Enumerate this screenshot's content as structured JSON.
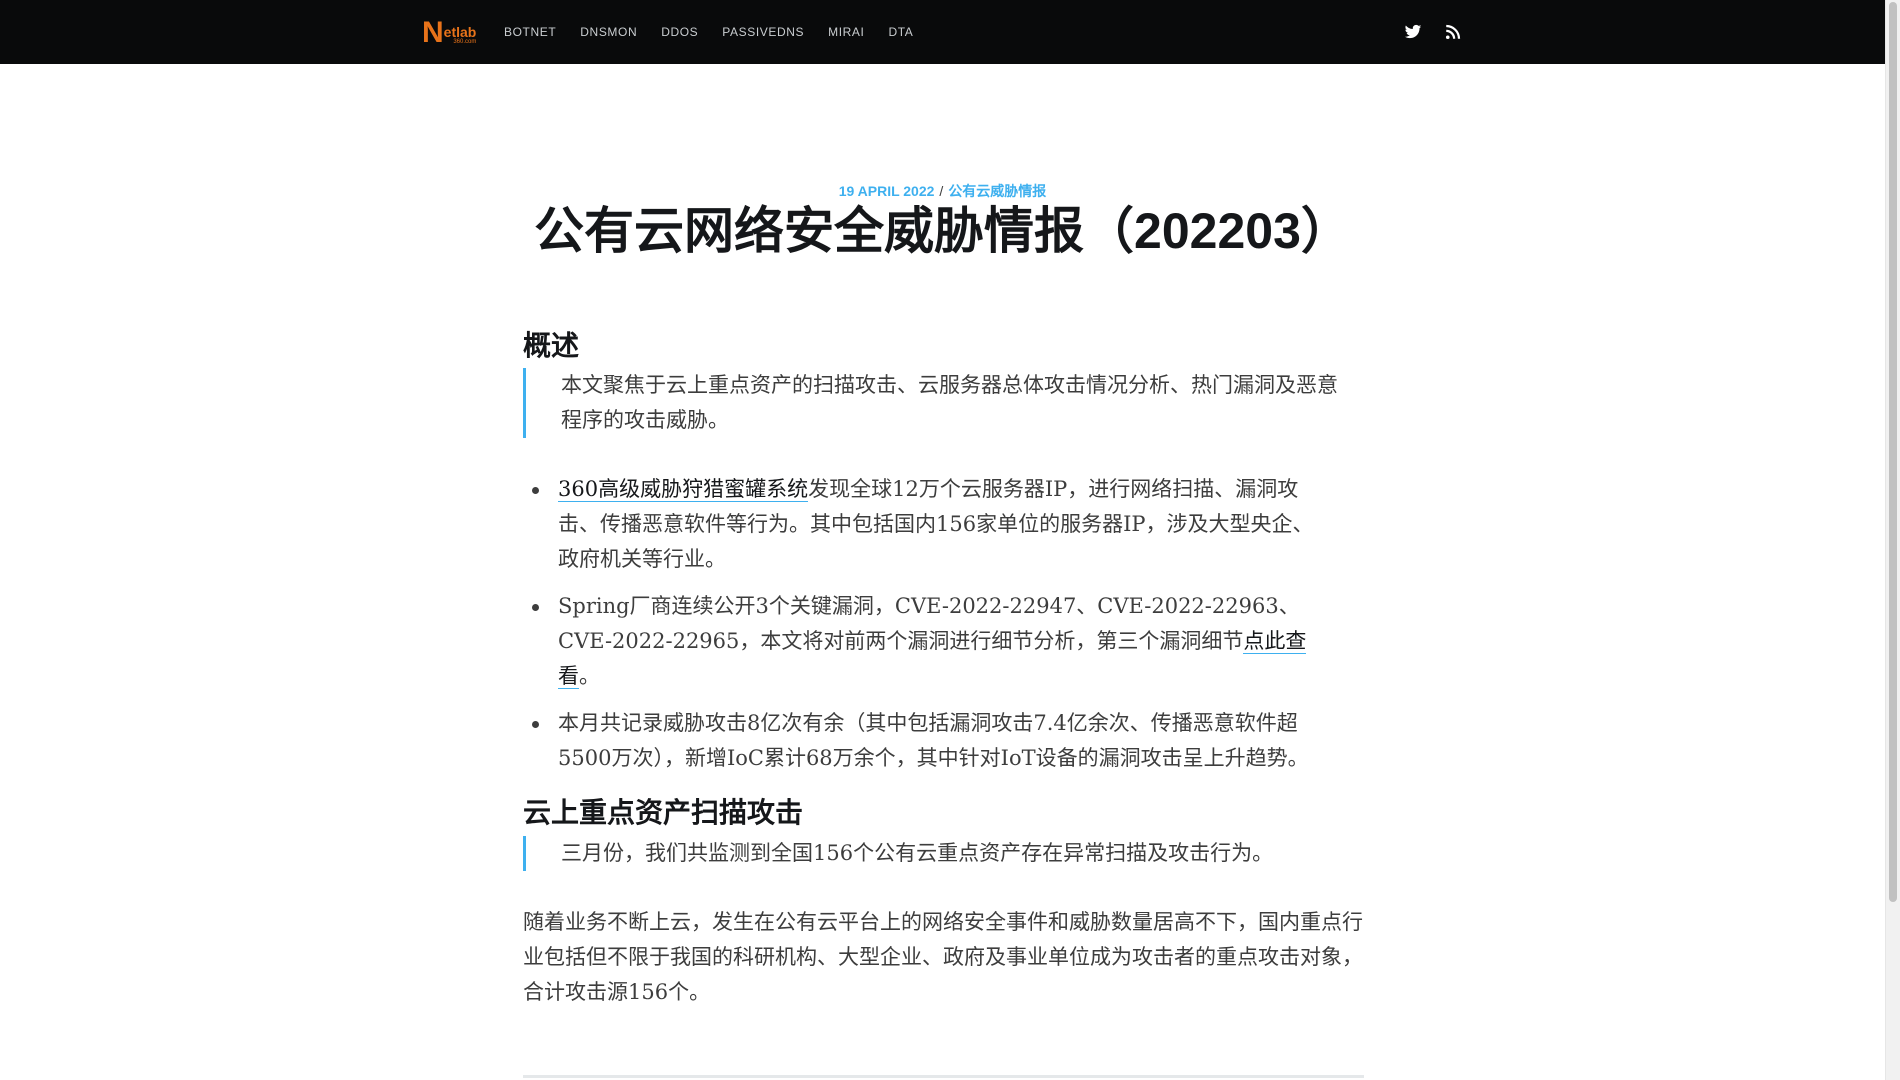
{
  "nav": {
    "logo_letter": "N",
    "logo_word": "etlab",
    "logo_sub": "360.com",
    "links": [
      "BOTNET",
      "DNSMON",
      "DDOS",
      "PASSIVEDNS",
      "MIRAI",
      "DTA"
    ],
    "icons": [
      "twitter-icon",
      "rss-icon"
    ]
  },
  "post": {
    "date": "19 APRIL 2022",
    "separator": "/",
    "tag": "公有云威胁情报",
    "title": "公有云网络安全威胁情报（202203）"
  },
  "sections": {
    "overview": {
      "heading": "概述",
      "quote": "本文聚焦于云上重点资产的扫描攻击、云服务器总体攻击情况分析、热门漏洞及恶意程序的攻击威胁。"
    },
    "bullets": {
      "b1_link": "360高级威胁狩猎蜜罐系统",
      "b1_text": "发现全球12万个云服务器IP，进行网络扫描、漏洞攻击、传播恶意软件等行为。其中包括国内156家单位的服务器IP，涉及大型央企、政府机关等行业。",
      "b2_text": "Spring厂商连续公开3个关键漏洞，CVE-2022-22947、CVE-2022-22963、CVE-2022-22965，本文将对前两个漏洞进行细节分析，第三个漏洞细节",
      "b2_link": "点此查看",
      "b2_end": "。",
      "b3_text": "本月共记录威胁攻击8亿次有余（其中包括漏洞攻击7.4亿余次、传播恶意软件超5500万次），新增IoC累计68万余个，其中针对IoT设备的漏洞攻击呈上升趋势。"
    },
    "scan": {
      "heading": "云上重点资产扫描攻击",
      "quote": "三月份，我们共监测到全国156个公有云重点资产存在异常扫描及攻击行为。",
      "paragraph": "随着业务不断上云，发生在公有云平台上的网络安全事件和威胁数量居高不下，国内重点行业包括但不限于我国的科研机构、大型企业、政府及事业单位成为攻击者的重点攻击对象，合计攻击源156个。"
    }
  },
  "colors": {
    "nav_bg": "#090a0b",
    "accent": "#3eb0ef",
    "logo": "#e8731a",
    "heading": "#15171a",
    "body_text": "#3d3d3d"
  }
}
